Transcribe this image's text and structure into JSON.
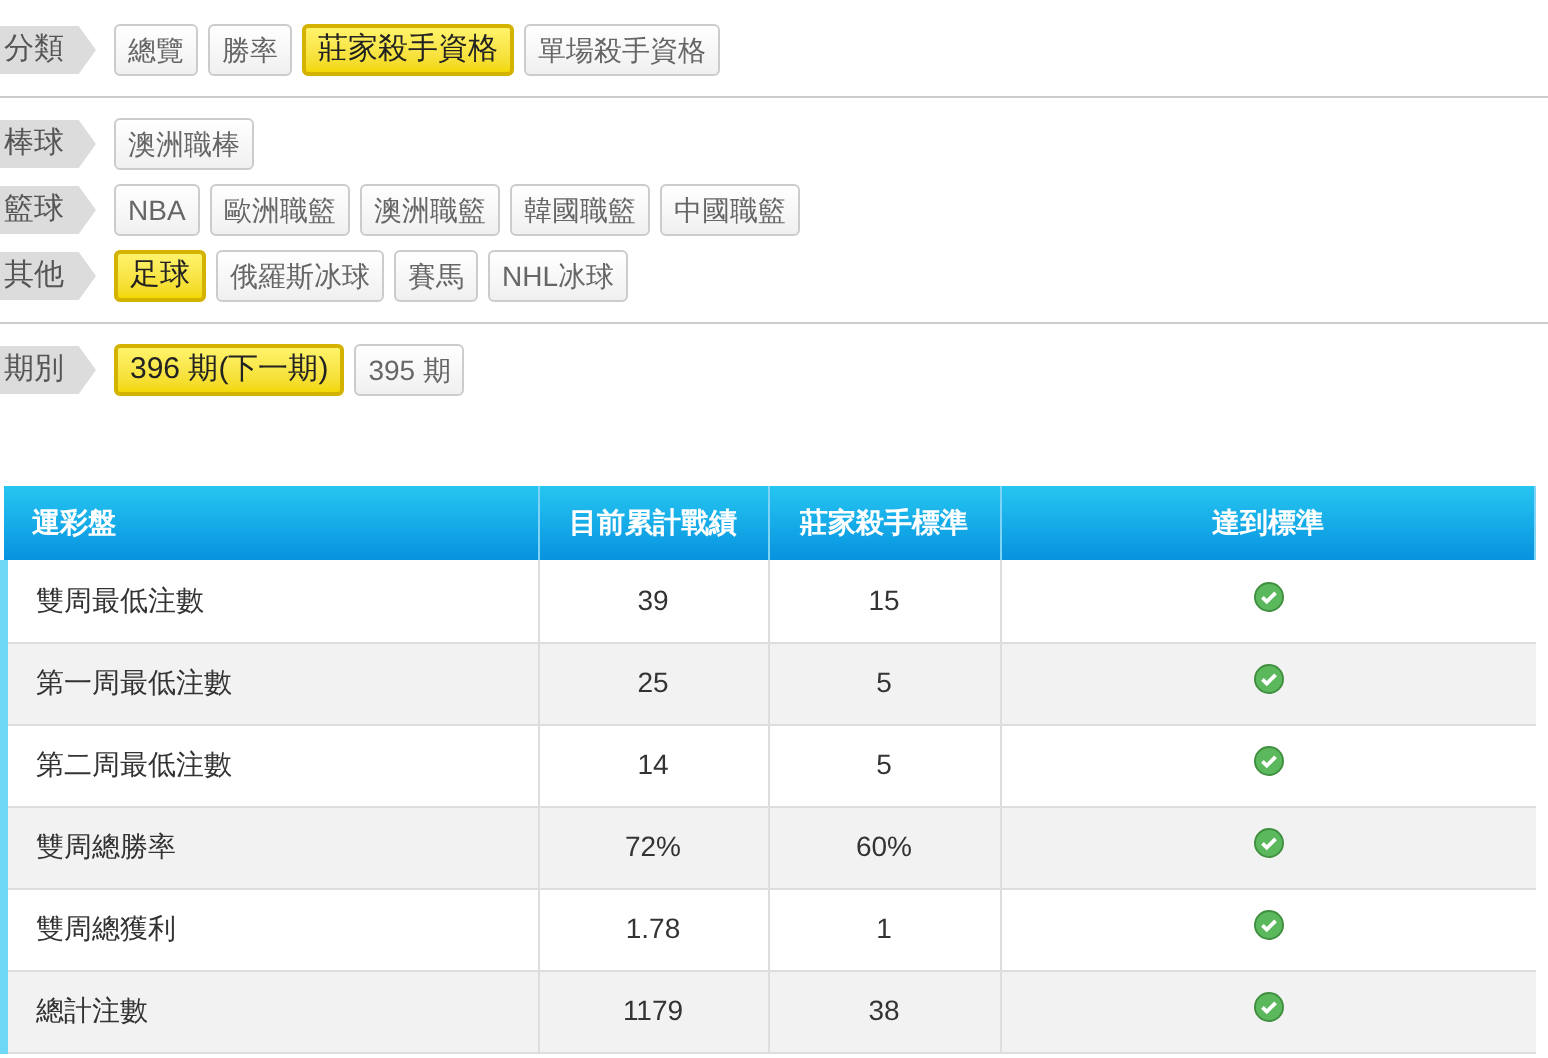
{
  "filter_groups": [
    {
      "label": "分類",
      "options": [
        {
          "label": "總覽",
          "selected": false
        },
        {
          "label": "勝率",
          "selected": false
        },
        {
          "label": "莊家殺手資格",
          "selected": true
        },
        {
          "label": "單場殺手資格",
          "selected": false
        }
      ],
      "divider_after": true
    },
    {
      "label": "棒球",
      "options": [
        {
          "label": "澳洲職棒",
          "selected": false
        }
      ],
      "divider_after": false
    },
    {
      "label": "籃球",
      "options": [
        {
          "label": "NBA",
          "selected": false
        },
        {
          "label": "歐洲職籃",
          "selected": false
        },
        {
          "label": "澳洲職籃",
          "selected": false
        },
        {
          "label": "韓國職籃",
          "selected": false
        },
        {
          "label": "中國職籃",
          "selected": false
        }
      ],
      "divider_after": false
    },
    {
      "label": "其他",
      "options": [
        {
          "label": "足球",
          "selected": true
        },
        {
          "label": "俄羅斯冰球",
          "selected": false
        },
        {
          "label": "賽馬",
          "selected": false
        },
        {
          "label": "NHL冰球",
          "selected": false
        }
      ],
      "divider_after": true
    },
    {
      "label": "期別",
      "options": [
        {
          "label": "396 期(下一期)",
          "selected": true
        },
        {
          "label": "395 期",
          "selected": false
        }
      ],
      "divider_after": false
    }
  ],
  "table": {
    "columns": [
      "運彩盤",
      "目前累計戰績",
      "莊家殺手標準",
      "達到標準"
    ],
    "rows": [
      {
        "name": "雙周最低注數",
        "current": "39",
        "standard": "15",
        "met": true
      },
      {
        "name": "第一周最低注數",
        "current": "25",
        "standard": "5",
        "met": true
      },
      {
        "name": "第二周最低注數",
        "current": "14",
        "standard": "5",
        "met": true
      },
      {
        "name": "雙周總勝率",
        "current": "72%",
        "standard": "60%",
        "met": true
      },
      {
        "name": "雙周總獲利",
        "current": "1.78",
        "standard": "1",
        "met": true
      },
      {
        "name": "總計注數",
        "current": "1179",
        "standard": "38",
        "met": true
      }
    ]
  }
}
